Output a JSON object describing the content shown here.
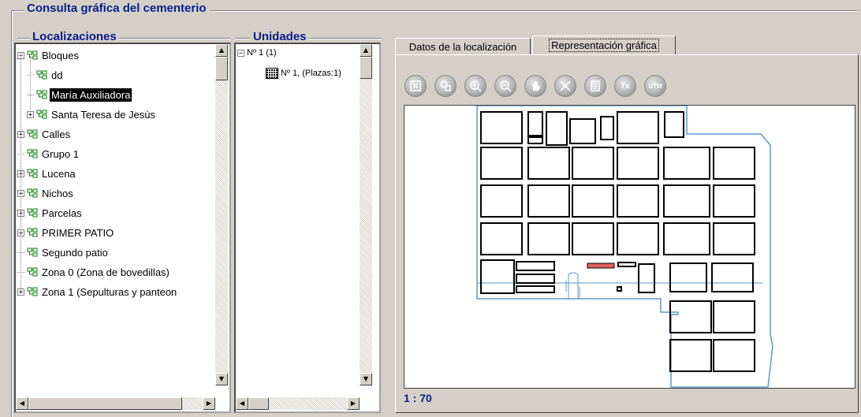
{
  "window": {
    "title": "Consulta gráfica del cementerio"
  },
  "localizaciones": {
    "title": "Localizaciones",
    "items": [
      {
        "label": "Bloques",
        "expander": "−",
        "level": 0
      },
      {
        "label": "dd",
        "expander": "",
        "level": 1
      },
      {
        "label": "María Auxiliadora",
        "expander": "",
        "level": 1,
        "selected": true
      },
      {
        "label": "Santa Teresa de Jesús",
        "expander": "+",
        "level": 1
      },
      {
        "label": "Calles",
        "expander": "+",
        "level": 0
      },
      {
        "label": "Grupo 1",
        "expander": "",
        "level": 0
      },
      {
        "label": "Lucena",
        "expander": "+",
        "level": 0
      },
      {
        "label": "Nichos",
        "expander": "+",
        "level": 0
      },
      {
        "label": "Parcelas",
        "expander": "+",
        "level": 0
      },
      {
        "label": "PRIMER PATIO",
        "expander": "+",
        "level": 0
      },
      {
        "label": "Segundo patio",
        "expander": "",
        "level": 0
      },
      {
        "label": "Zona 0 (Zona de bovedillas)",
        "expander": "",
        "level": 0
      },
      {
        "label": "Zona 1 (Sepulturas y panteon",
        "expander": "+",
        "level": 0
      }
    ]
  },
  "unidades": {
    "title": "Unidades",
    "root": {
      "label": "Nº 1  (1)",
      "expander": "−"
    },
    "child": {
      "label": "Nº 1, (Plazas:1)"
    }
  },
  "tabs": [
    {
      "label": "Datos de la localización",
      "active": false
    },
    {
      "label": "Representación gráfica",
      "active": true
    }
  ],
  "toolbar": [
    {
      "icon": "zoom-extents-icon"
    },
    {
      "icon": "zoom-window-icon"
    },
    {
      "icon": "zoom-in-icon"
    },
    {
      "icon": "zoom-out-icon"
    },
    {
      "icon": "pan-hand-icon"
    },
    {
      "icon": "center-icon"
    },
    {
      "icon": "list-icon"
    },
    {
      "icon": "text-icon",
      "text": "Tx"
    },
    {
      "icon": "utm-icon",
      "text": "UTM"
    }
  ],
  "scale": "1 : 70",
  "colors": {
    "title": "#0a1e8c",
    "outline": "#5a9ac8",
    "highlight": "#e06060"
  }
}
